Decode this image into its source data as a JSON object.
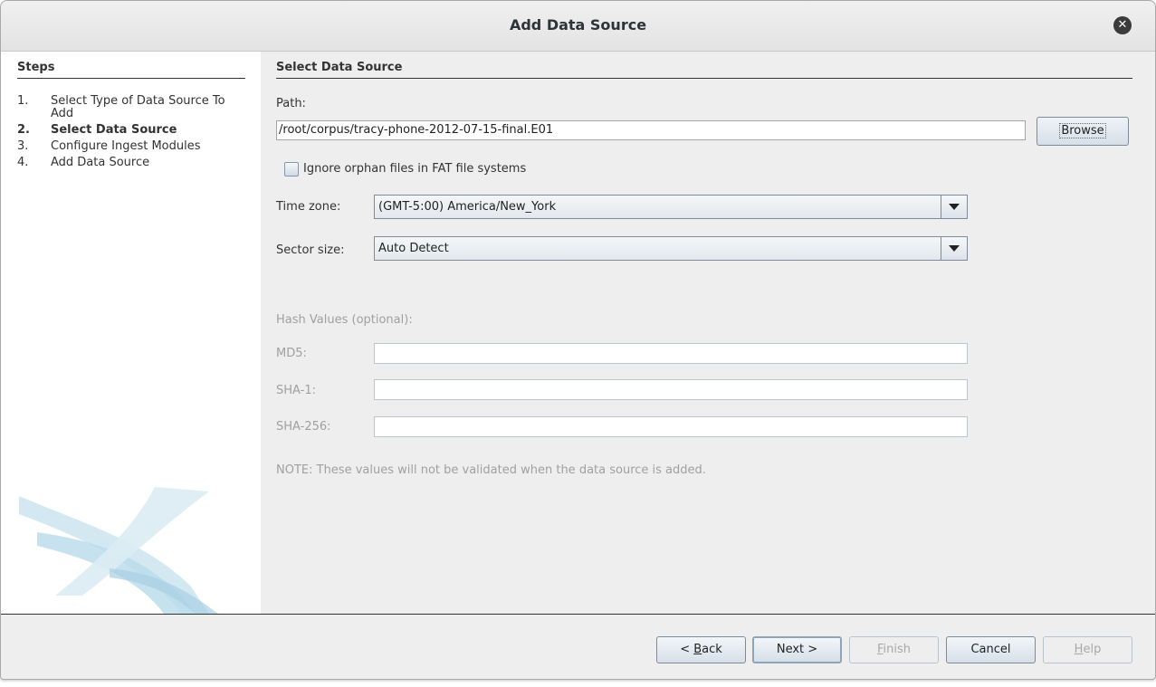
{
  "window": {
    "title": "Add Data Source"
  },
  "steps": {
    "header": "Steps",
    "items": [
      {
        "num": "1.",
        "label": "Select Type of Data Source To Add",
        "active": false
      },
      {
        "num": "2.",
        "label": "Select Data Source",
        "active": true
      },
      {
        "num": "3.",
        "label": "Configure Ingest Modules",
        "active": false
      },
      {
        "num": "4.",
        "label": "Add Data Source",
        "active": false
      }
    ]
  },
  "form": {
    "section_title": "Select Data Source",
    "path_label": "Path:",
    "path_value": "/root/corpus/tracy-phone-2012-07-15-final.E01",
    "browse_label": "Browse",
    "orphan_label": "Ignore orphan files in FAT file systems",
    "orphan_checked": false,
    "timezone_label": "Time zone:",
    "timezone_value": "(GMT-5:00) America/New_York",
    "sector_label": "Sector size:",
    "sector_value": "Auto Detect",
    "hash_header": "Hash Values (optional):",
    "md5_label": "MD5:",
    "md5_value": "",
    "sha1_label": "SHA-1:",
    "sha1_value": "",
    "sha256_label": "SHA-256:",
    "sha256_value": "",
    "note": "NOTE: These values will not be validated when the data source is added."
  },
  "buttons": {
    "back_prefix": "< ",
    "back_mnemonic": "B",
    "back_rest": "ack",
    "next": "Next >",
    "finish_mnemonic": "F",
    "finish_rest": "inish",
    "cancel": "Cancel",
    "help_mnemonic": "H",
    "help_rest": "elp"
  },
  "colors": {
    "panel_bg": "#eeeeee",
    "sidebar_bg": "#ffffff",
    "disabled_text": "#a0a0a0"
  }
}
